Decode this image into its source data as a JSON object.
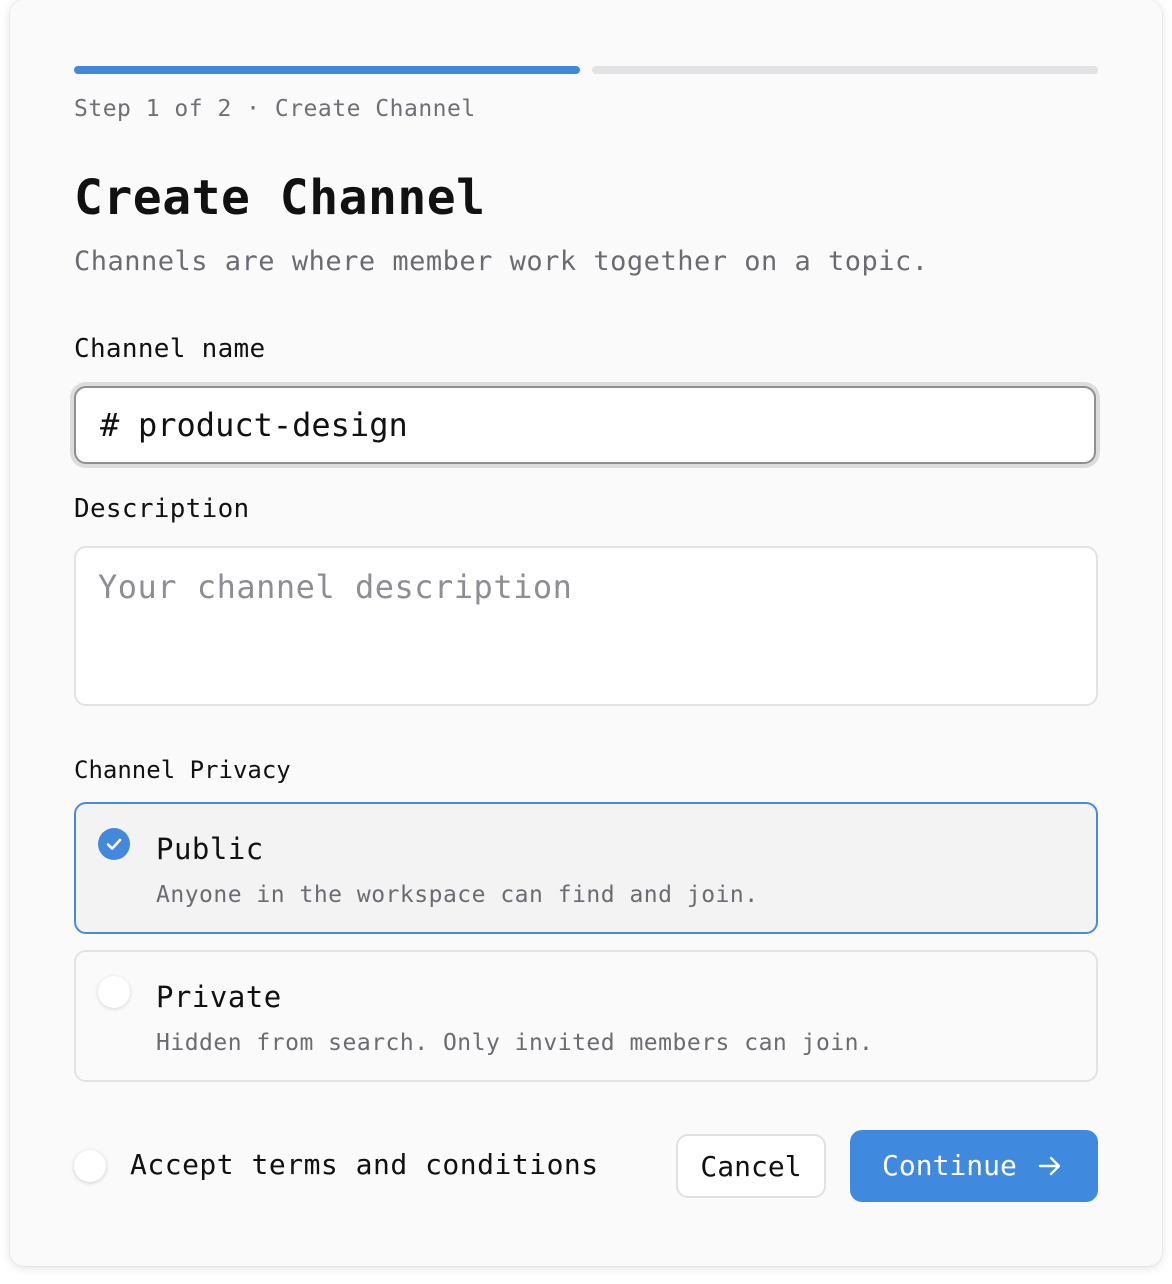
{
  "colors": {
    "accent": "#3f89df",
    "progress_done": "#4388dc",
    "progress_todo": "#e2e2e4",
    "selected_border": "#4a8ad9"
  },
  "progress": {
    "current_step": 1,
    "total_steps": 2,
    "label": "Step 1 of 2 · Create Channel"
  },
  "header": {
    "title": "Create Channel",
    "subtitle": "Channels are where member work together on a topic."
  },
  "form": {
    "name": {
      "label": "Channel name",
      "prefix": "#",
      "value": "product-design",
      "prefix_icon": "hash-icon"
    },
    "description": {
      "label": "Description",
      "value": "",
      "placeholder": "Your channel description"
    },
    "privacy": {
      "label": "Channel Privacy",
      "selected": "public",
      "options": [
        {
          "id": "public",
          "title": "Public",
          "description": "Anyone in the workspace can find and join.",
          "checked": true,
          "icon": "check-icon"
        },
        {
          "id": "private",
          "title": "Private",
          "description": "Hidden from search. Only invited members can join.",
          "checked": false
        }
      ]
    },
    "terms": {
      "label": "Accept terms and conditions",
      "checked": false
    }
  },
  "actions": {
    "cancel_label": "Cancel",
    "continue_label": "Continue",
    "continue_icon": "arrow-right-icon"
  }
}
